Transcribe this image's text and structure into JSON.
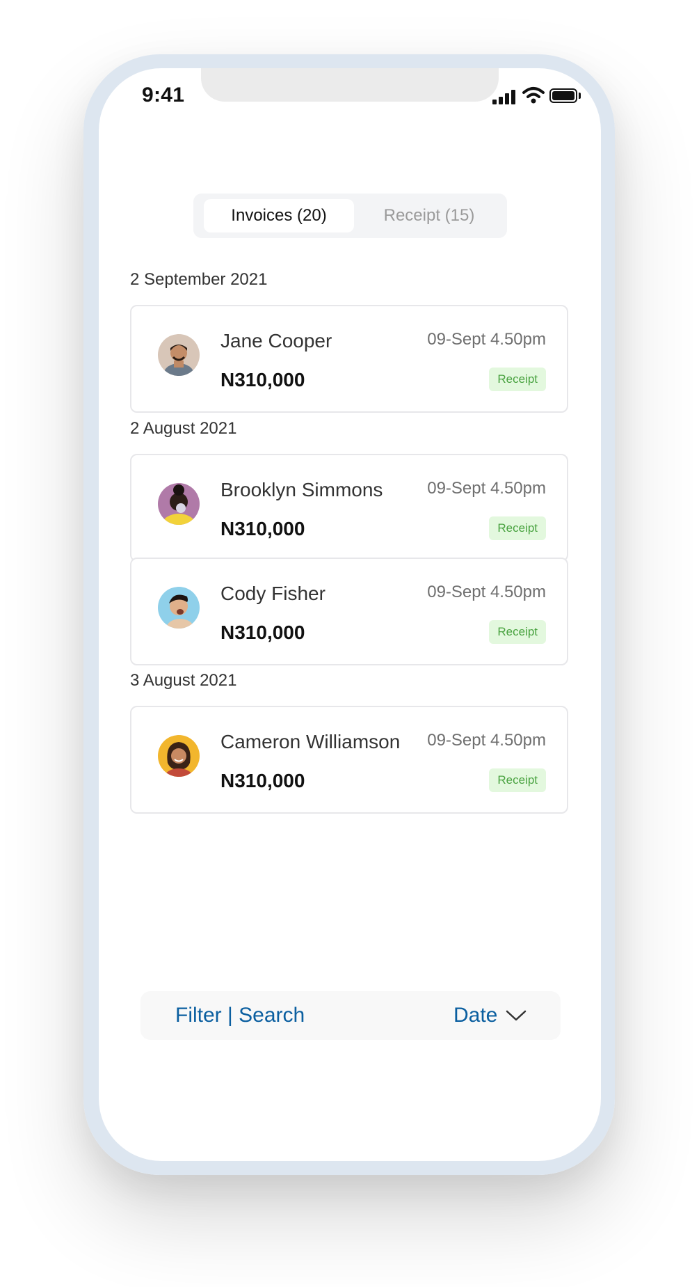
{
  "status_bar": {
    "time": "9:41"
  },
  "tabs": [
    {
      "label": "Invoices (20)",
      "active": true
    },
    {
      "label": "Receipt (15)",
      "active": false
    }
  ],
  "groups": [
    {
      "date": "2 September 2021",
      "items": [
        {
          "name": "Jane Cooper",
          "amount": "N310,000",
          "time": "09-Sept 4.50pm",
          "badge": "Receipt",
          "avatar_bg": "#d8c6b8"
        }
      ]
    },
    {
      "date": "2 August 2021",
      "items": [
        {
          "name": "Brooklyn Simmons",
          "amount": "N310,000",
          "time": "09-Sept 4.50pm",
          "badge": "Receipt",
          "avatar_bg": "#b07aa8"
        },
        {
          "name": "Cody Fisher",
          "amount": "N310,000",
          "time": "09-Sept 4.50pm",
          "badge": "Receipt",
          "avatar_bg": "#8fd0ea"
        }
      ]
    },
    {
      "date": "3  August 2021",
      "items": [
        {
          "name": "Cameron Williamson",
          "amount": "N310,000",
          "time": "09-Sept 4.50pm",
          "badge": "Receipt",
          "avatar_bg": "#f2b62d"
        }
      ]
    }
  ],
  "bottom_bar": {
    "filter_label": "Filter | Search",
    "sort_label": "Date"
  },
  "colors": {
    "accent": "#0b5fa0",
    "badge_bg": "#e3f8de",
    "badge_text": "#48a23f"
  }
}
